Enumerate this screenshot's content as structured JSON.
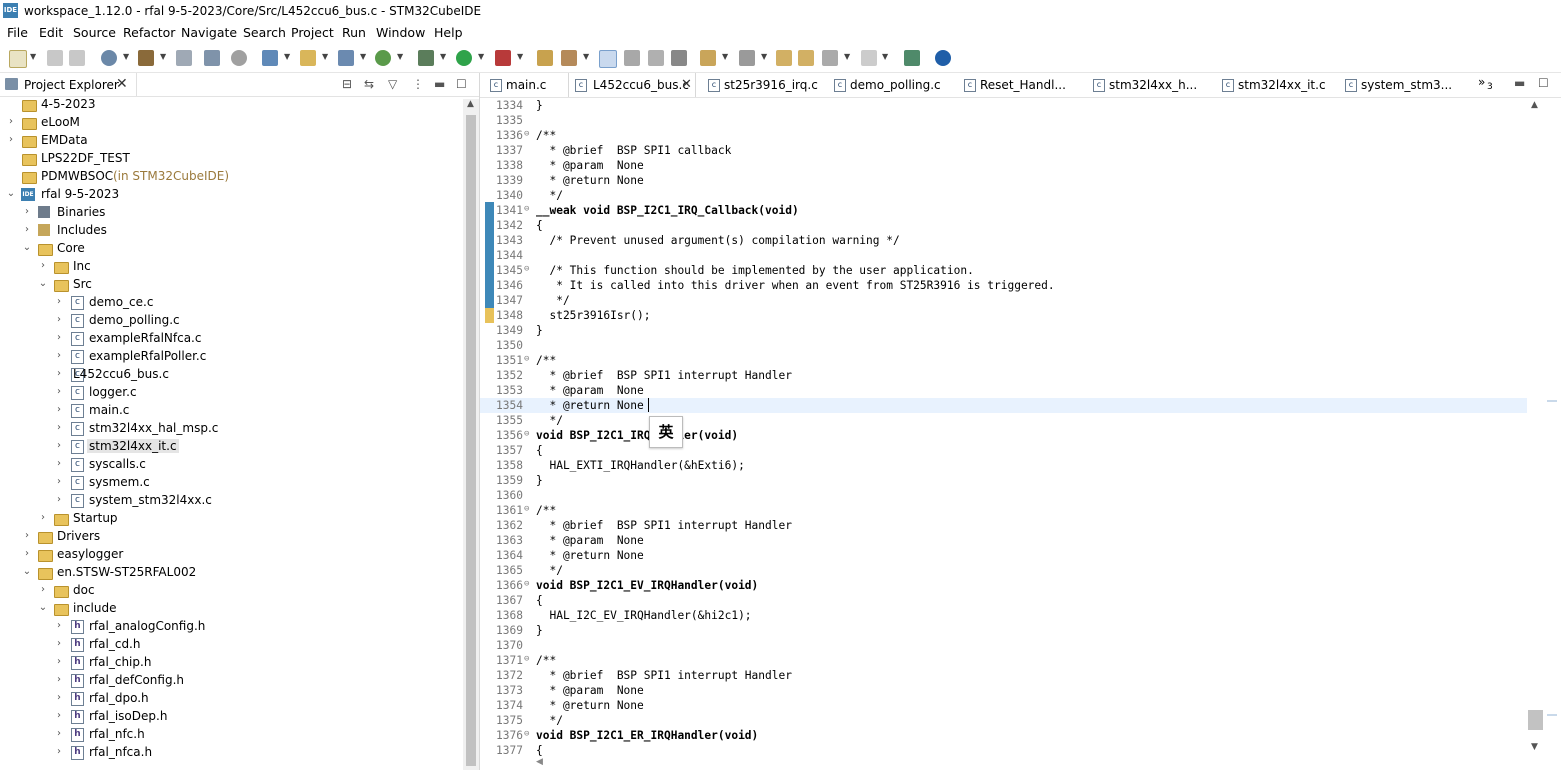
{
  "window": {
    "title": "workspace_1.12.0 - rfal 9-5-2023/Core/Src/L452ccu6_bus.c - STM32CubeIDE",
    "icon_text": "IDE"
  },
  "menu": [
    "File",
    "Edit",
    "Source",
    "Refactor",
    "Navigate",
    "Search",
    "Project",
    "Run",
    "Window",
    "Help"
  ],
  "project_explorer": {
    "tab_label": "Project Explorer",
    "items": [
      {
        "label": "4-5-2023",
        "icon": "project-folder-icon"
      },
      {
        "label": "eLooM",
        "icon": "project-folder-icon"
      },
      {
        "label": "EMData",
        "icon": "project-folder-icon"
      },
      {
        "label": "LPS22DF_TEST",
        "icon": "project-folder-icon"
      },
      {
        "label": "PDMWBSOC",
        "decoration": "(in STM32CubeIDE)",
        "icon": "project-folder-icon"
      },
      {
        "label": "rfal 9-5-2023",
        "icon": "ide-project-icon"
      },
      {
        "label": "Binaries",
        "icon": "binaries-icon"
      },
      {
        "label": "Includes",
        "icon": "includes-icon"
      },
      {
        "label": "Core",
        "icon": "folder-icon"
      },
      {
        "label": "Inc",
        "icon": "folder-icon"
      },
      {
        "label": "Src",
        "icon": "folder-icon"
      },
      {
        "label": "demo_ce.c",
        "icon": "c-file-icon"
      },
      {
        "label": "demo_polling.c",
        "icon": "c-file-icon"
      },
      {
        "label": "exampleRfalNfca.c",
        "icon": "c-file-icon"
      },
      {
        "label": "exampleRfalPoller.c",
        "icon": "c-file-icon"
      },
      {
        "label": "L452ccu6_bus.c",
        "icon": "c-file-icon"
      },
      {
        "label": "logger.c",
        "icon": "c-file-icon"
      },
      {
        "label": "main.c",
        "icon": "c-file-icon"
      },
      {
        "label": "stm32l4xx_hal_msp.c",
        "icon": "c-file-icon"
      },
      {
        "label": "stm32l4xx_it.c",
        "icon": "c-file-icon"
      },
      {
        "label": "syscalls.c",
        "icon": "c-file-icon"
      },
      {
        "label": "sysmem.c",
        "icon": "c-file-icon"
      },
      {
        "label": "system_stm32l4xx.c",
        "icon": "c-file-icon"
      },
      {
        "label": "Startup",
        "icon": "folder-icon"
      },
      {
        "label": "Drivers",
        "icon": "folder-icon"
      },
      {
        "label": "easylogger",
        "icon": "folder-icon"
      },
      {
        "label": "en.STSW-ST25RFAL002",
        "icon": "folder-icon"
      },
      {
        "label": "doc",
        "icon": "folder-icon"
      },
      {
        "label": "include",
        "icon": "folder-icon"
      },
      {
        "label": "rfal_analogConfig.h",
        "icon": "h-file-icon"
      },
      {
        "label": "rfal_cd.h",
        "icon": "h-file-icon"
      },
      {
        "label": "rfal_chip.h",
        "icon": "h-file-icon"
      },
      {
        "label": "rfal_defConfig.h",
        "icon": "h-file-icon"
      },
      {
        "label": "rfal_dpo.h",
        "icon": "h-file-icon"
      },
      {
        "label": "rfal_isoDep.h",
        "icon": "h-file-icon"
      },
      {
        "label": "rfal_nfc.h",
        "icon": "h-file-icon"
      },
      {
        "label": "rfal_nfca.h",
        "icon": "h-file-icon"
      }
    ]
  },
  "editor_tabs": [
    {
      "label": "main.c"
    },
    {
      "label": "L452ccu6_bus.c",
      "active": true
    },
    {
      "label": "st25r3916_irq.c"
    },
    {
      "label": "demo_polling.c"
    },
    {
      "label": "Reset_Handl..."
    },
    {
      "label": "stm32l4xx_h..."
    },
    {
      "label": "stm32l4xx_it.c"
    },
    {
      "label": "system_stm3..."
    }
  ],
  "overflow_tabs_count": "3",
  "ime_indicator": "英",
  "code_lines": [
    {
      "n": "1334",
      "t": "}"
    },
    {
      "n": "1335",
      "t": ""
    },
    {
      "n": "1336",
      "t": "/**"
    },
    {
      "n": "1337",
      "t": "  * @brief  BSP SPI1 callback"
    },
    {
      "n": "1338",
      "t": "  * @param  None"
    },
    {
      "n": "1339",
      "t": "  * @return None"
    },
    {
      "n": "1340",
      "t": "  */"
    },
    {
      "n": "1341",
      "t": "__weak void BSP_I2C1_IRQ_Callback(void)"
    },
    {
      "n": "1342",
      "t": "{"
    },
    {
      "n": "1343",
      "t": "  /* Prevent unused argument(s) compilation warning */"
    },
    {
      "n": "1344",
      "t": ""
    },
    {
      "n": "1345",
      "t": "  /* This function should be implemented by the user application."
    },
    {
      "n": "1346",
      "t": "   * It is called into this driver when an event from ST25R3916 is triggered."
    },
    {
      "n": "1347",
      "t": "   */"
    },
    {
      "n": "1348",
      "t": "  st25r3916Isr();"
    },
    {
      "n": "1349",
      "t": "}"
    },
    {
      "n": "1350",
      "t": ""
    },
    {
      "n": "1351",
      "t": "/**"
    },
    {
      "n": "1352",
      "t": "  * @brief  BSP SPI1 interrupt Handler"
    },
    {
      "n": "1353",
      "t": "  * @param  None"
    },
    {
      "n": "1354",
      "t": "  * @return None"
    },
    {
      "n": "1355",
      "t": "  */"
    },
    {
      "n": "1356",
      "t": "void BSP_I2C1_IRQHandler(void)"
    },
    {
      "n": "1357",
      "t": "{"
    },
    {
      "n": "1358",
      "t": "  HAL_EXTI_IRQHandler(&hExti6);"
    },
    {
      "n": "1359",
      "t": "}"
    },
    {
      "n": "1360",
      "t": ""
    },
    {
      "n": "1361",
      "t": "/**"
    },
    {
      "n": "1362",
      "t": "  * @brief  BSP SPI1 interrupt Handler"
    },
    {
      "n": "1363",
      "t": "  * @param  None"
    },
    {
      "n": "1364",
      "t": "  * @return None"
    },
    {
      "n": "1365",
      "t": "  */"
    },
    {
      "n": "1366",
      "t": "void BSP_I2C1_EV_IRQHandler(void)"
    },
    {
      "n": "1367",
      "t": "{"
    },
    {
      "n": "1368",
      "t": "  HAL_I2C_EV_IRQHandler(&hi2c1);"
    },
    {
      "n": "1369",
      "t": "}"
    },
    {
      "n": "1370",
      "t": ""
    },
    {
      "n": "1371",
      "t": "/**"
    },
    {
      "n": "1372",
      "t": "  * @brief  BSP SPI1 interrupt Handler"
    },
    {
      "n": "1373",
      "t": "  * @param  None"
    },
    {
      "n": "1374",
      "t": "  * @return None"
    },
    {
      "n": "1375",
      "t": "  */"
    },
    {
      "n": "1376",
      "t": "void BSP_I2C1_ER_IRQHandler(void)"
    },
    {
      "n": "1377",
      "t": "{"
    }
  ],
  "colors": {
    "keyword": "#7f0055",
    "comment": "#3f7f5f",
    "doc_tag": "#7f9fbf",
    "change_bar": "#3e88b8",
    "current_line": "#e8f2fe"
  }
}
